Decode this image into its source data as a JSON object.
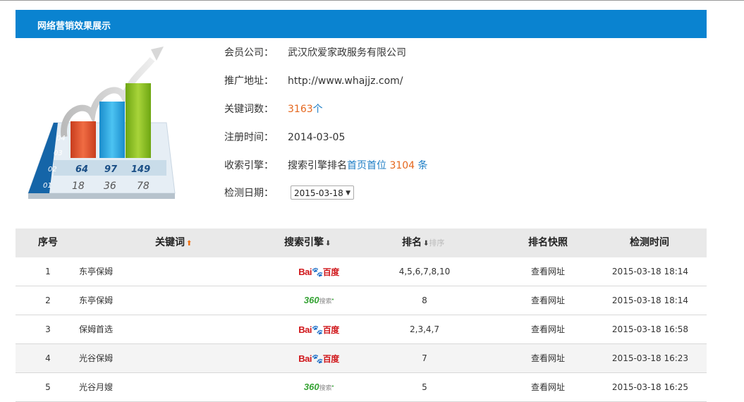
{
  "page": {
    "title": "网络营销效果展示"
  },
  "chart_data": {
    "type": "bar",
    "rows": [
      "04",
      "03",
      "02",
      "01"
    ],
    "values_row02": [
      64,
      97,
      149
    ],
    "values_row01": [
      18,
      36,
      78
    ],
    "colors": [
      "#e8532f",
      "#27a9e4",
      "#8fc21e"
    ]
  },
  "info": {
    "company_label": "会员公司：",
    "company_value": "武汉欣爱家政服务有限公司",
    "url_label": "推广地址：",
    "url_value": "http://www.whajjz.com/",
    "keywords_label": "关键词数：",
    "keywords_count": "3163",
    "keywords_unit": "个",
    "register_label": "注册时间：",
    "register_value": "2014-03-05",
    "engine_label": "收索引擎：",
    "engine_prefix": "搜索引擎排名",
    "engine_link": "首页首位",
    "engine_count": "3104",
    "engine_unit": "条",
    "date_label": "检测日期：",
    "date_value": "2015-03-18"
  },
  "table": {
    "headers": {
      "index": "序号",
      "keyword": "关键词",
      "engine": "搜索引擎",
      "rank": "排名",
      "rank_sort": "排序",
      "snapshot": "排名快照",
      "time": "检测时间"
    },
    "rows": [
      {
        "index": "1",
        "keyword": "东亭保姆",
        "engine": "baidu",
        "rank": "4,5,6,7,8,10",
        "snapshot": "查看网址",
        "time": "2015-03-18 18:14"
      },
      {
        "index": "2",
        "keyword": "东亭保姆",
        "engine": "360",
        "rank": "8",
        "snapshot": "查看网址",
        "time": "2015-03-18 18:14"
      },
      {
        "index": "3",
        "keyword": "保姆首选",
        "engine": "baidu",
        "rank": "2,3,4,7",
        "snapshot": "查看网址",
        "time": "2015-03-18 16:58"
      },
      {
        "index": "4",
        "keyword": "光谷保姆",
        "engine": "baidu",
        "rank": "7",
        "snapshot": "查看网址",
        "time": "2015-03-18 16:23"
      },
      {
        "index": "5",
        "keyword": "光谷月嫂",
        "engine": "360",
        "rank": "5",
        "snapshot": "查看网址",
        "time": "2015-03-18 16:25"
      }
    ]
  },
  "logos": {
    "baidu_a": "Bai",
    "baidu_paw": "🐾",
    "baidu_b": "百度",
    "s360_a": "360",
    "s360_b": "搜索",
    "s360_star": "•"
  }
}
